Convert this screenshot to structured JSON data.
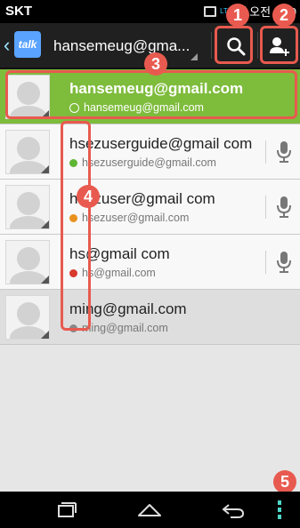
{
  "status_bar": {
    "carrier": "SKT",
    "network": "LTE",
    "time": "오전 2:50"
  },
  "action_bar": {
    "app_logo": "talk",
    "account": "hansemeug@gma...",
    "buttons": [
      {
        "icon": "search-icon"
      },
      {
        "icon": "add-contact-icon"
      }
    ]
  },
  "contacts": [
    {
      "name": "hansemeug@gmail.com",
      "status": "hansemeug@gmail.com",
      "presence": "self",
      "dot_color": "#ffffff"
    },
    {
      "name": "hsezuserguide@gmail com",
      "status": "hsezuserguide@gmail.com",
      "presence": "available",
      "dot_color": "#5fb633"
    },
    {
      "name": "hsezuser@gmail com",
      "status": "hsezuser@gmail.com",
      "presence": "idle",
      "dot_color": "#e8901e"
    },
    {
      "name": "hs@gmail com",
      "status": "hs@gmail.com",
      "presence": "busy",
      "dot_color": "#d83a2e"
    },
    {
      "name": "ming@gmail.com",
      "status": "ming@gmail.com",
      "presence": "offline",
      "dot_color": "#888888"
    }
  ],
  "callouts": [
    "1",
    "2",
    "3",
    "4",
    "5"
  ],
  "nav_bar": {
    "buttons": [
      "recent-apps-icon",
      "home-icon",
      "back-icon",
      "menu-icon"
    ]
  },
  "colors": {
    "self_row": "#7ebc3c",
    "callout": "#e85a4f",
    "menu_accent": "#4fd7c8"
  }
}
